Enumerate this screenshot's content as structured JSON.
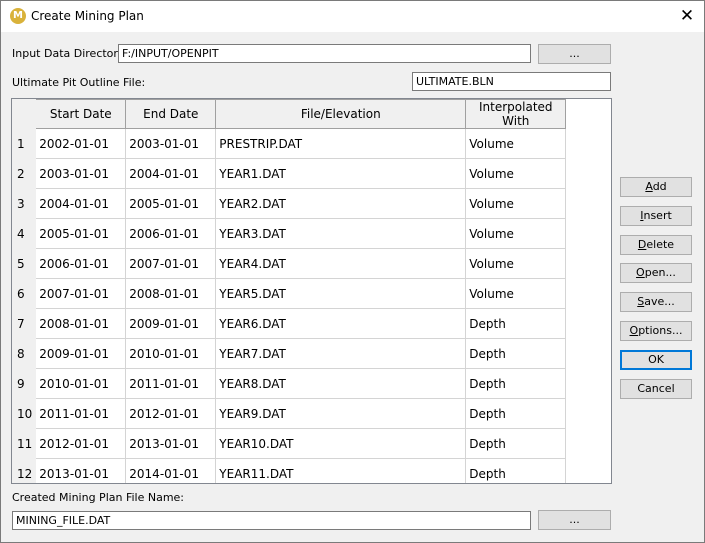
{
  "window": {
    "title": "Create Mining Plan",
    "app_icon_glyph": "M"
  },
  "input_dir": {
    "label": "Input Data Directory:",
    "value": "F:/INPUT/OPENPIT",
    "browse_label": "..."
  },
  "outline": {
    "label": "Ultimate Pit Outline File:",
    "value": "ULTIMATE.BLN"
  },
  "table": {
    "headers": [
      "Start Date",
      "End Date",
      "File/Elevation",
      "Interpolated With"
    ],
    "rows": [
      {
        "n": "1",
        "start": "2002-01-01",
        "end": "2003-01-01",
        "file": "PRESTRIP.DAT",
        "interp": "Volume"
      },
      {
        "n": "2",
        "start": "2003-01-01",
        "end": "2004-01-01",
        "file": "YEAR1.DAT",
        "interp": "Volume"
      },
      {
        "n": "3",
        "start": "2004-01-01",
        "end": "2005-01-01",
        "file": "YEAR2.DAT",
        "interp": "Volume"
      },
      {
        "n": "4",
        "start": "2005-01-01",
        "end": "2006-01-01",
        "file": "YEAR3.DAT",
        "interp": "Volume"
      },
      {
        "n": "5",
        "start": "2006-01-01",
        "end": "2007-01-01",
        "file": "YEAR4.DAT",
        "interp": "Volume"
      },
      {
        "n": "6",
        "start": "2007-01-01",
        "end": "2008-01-01",
        "file": "YEAR5.DAT",
        "interp": "Volume"
      },
      {
        "n": "7",
        "start": "2008-01-01",
        "end": "2009-01-01",
        "file": "YEAR6.DAT",
        "interp": "Depth"
      },
      {
        "n": "8",
        "start": "2009-01-01",
        "end": "2010-01-01",
        "file": "YEAR7.DAT",
        "interp": "Depth"
      },
      {
        "n": "9",
        "start": "2010-01-01",
        "end": "2011-01-01",
        "file": "YEAR8.DAT",
        "interp": "Depth"
      },
      {
        "n": "10",
        "start": "2011-01-01",
        "end": "2012-01-01",
        "file": "YEAR9.DAT",
        "interp": "Depth"
      },
      {
        "n": "11",
        "start": "2012-01-01",
        "end": "2013-01-01",
        "file": "YEAR10.DAT",
        "interp": "Depth"
      },
      {
        "n": "12",
        "start": "2013-01-01",
        "end": "2014-01-01",
        "file": "YEAR11.DAT",
        "interp": "Depth"
      }
    ]
  },
  "buttons": {
    "add": {
      "ul": "A",
      "rest": "dd"
    },
    "insert": {
      "ul": "I",
      "rest": "nsert"
    },
    "delete": {
      "ul": "D",
      "rest": "elete"
    },
    "open": {
      "ul": "O",
      "rest": "pen..."
    },
    "save": {
      "ul": "S",
      "rest": "ave..."
    },
    "options": {
      "ul": "O",
      "rest": "ptions..."
    },
    "ok": "OK",
    "cancel": "Cancel"
  },
  "output": {
    "label": "Created Mining Plan File Name:",
    "value": "MINING_FILE.DAT",
    "browse_label": "..."
  },
  "colors": {
    "default_button_border": "#0078d7",
    "title_bg": "#ffffff",
    "dialog_bg": "#f0f0f0"
  }
}
